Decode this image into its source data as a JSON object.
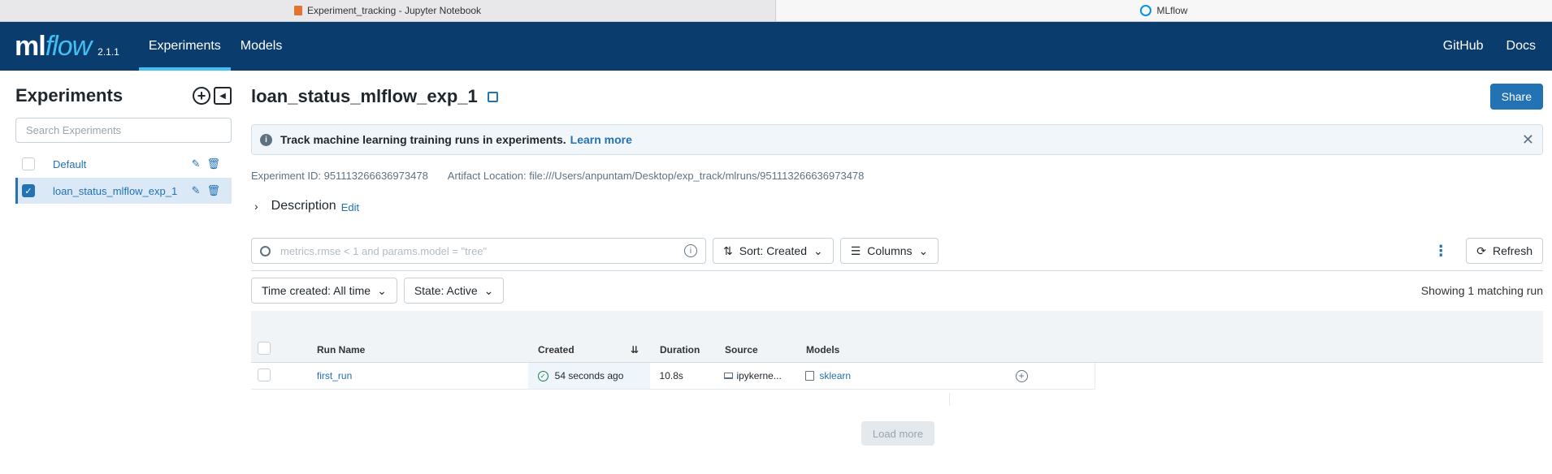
{
  "browser_tabs": [
    {
      "title": "Experiment_tracking - Jupyter Notebook",
      "icon": "notebook-icon"
    },
    {
      "title": "MLflow",
      "icon": "mlflow-icon"
    }
  ],
  "header": {
    "logo_ml": "ml",
    "logo_flow": "flow",
    "version": "2.1.1",
    "nav": [
      "Experiments",
      "Models"
    ],
    "nav_right": [
      "GitHub",
      "Docs"
    ],
    "bg_color": "#0a3c6e",
    "accent_color": "#43c0f3"
  },
  "sidebar": {
    "title": "Experiments",
    "search_placeholder": "Search Experiments",
    "items": [
      {
        "name": "Default",
        "checked": false
      },
      {
        "name": "loan_status_mlflow_exp_1",
        "checked": true
      }
    ]
  },
  "main": {
    "title": "loan_status_mlflow_exp_1",
    "share_label": "Share",
    "banner_text": "Track machine learning training runs in experiments.",
    "banner_link": "Learn more",
    "experiment_id": "Experiment ID: 951113266636973478",
    "artifact_location": "Artifact Location: file:///Users/anpuntam/Desktop/exp_track/mlruns/951113266636973478",
    "description_label": "Description",
    "description_edit": "Edit",
    "search_placeholder": "metrics.rmse < 1 and params.model = \"tree\"",
    "sort_label": "Sort: Created",
    "columns_label": "Columns",
    "refresh_label": "Refresh",
    "time_filter": "Time created: All time",
    "state_filter": "State: Active",
    "showing": "Showing 1 matching run",
    "load_more": "Load more"
  },
  "table": {
    "columns": [
      "Run Name",
      "Created",
      "Duration",
      "Source",
      "Models"
    ],
    "rows": [
      {
        "run_name": "first_run",
        "created": "54 seconds ago",
        "duration": "10.8s",
        "source": "ipykerne...",
        "models": "sklearn"
      }
    ]
  }
}
